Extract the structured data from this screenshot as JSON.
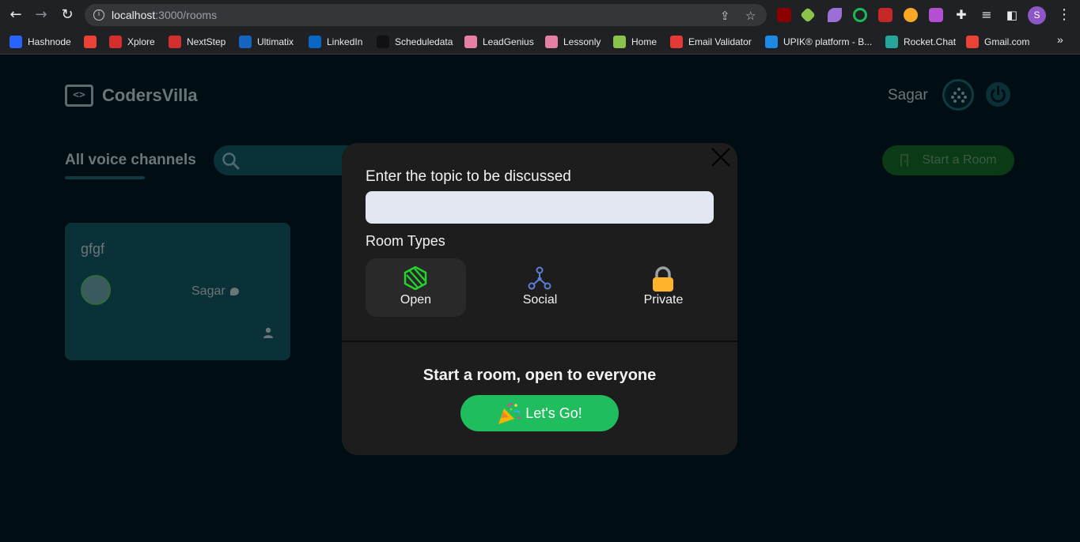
{
  "browser": {
    "url_host": "localhost",
    "url_path": ":3000/rooms",
    "profile_initial": "S",
    "bookmarks": [
      {
        "label": "Hashnode",
        "icon": "hashnode-icon",
        "color": "#2962ff"
      },
      {
        "label": "",
        "icon": "gmail-icon",
        "color": "#ea4335"
      },
      {
        "label": "Xplore",
        "icon": "tcs-icon",
        "color": "#d32f2f"
      },
      {
        "label": "NextStep",
        "icon": "tcs-icon",
        "color": "#d32f2f"
      },
      {
        "label": "Ultimatix",
        "icon": "tata-icon",
        "color": "#1565c0"
      },
      {
        "label": "LinkedIn",
        "icon": "linkedin-icon",
        "color": "#0a66c2"
      },
      {
        "label": "Scheduledata",
        "icon": "scheduledata-icon",
        "color": "#111111"
      },
      {
        "label": "LeadGenius",
        "icon": "brain-icon",
        "color": "#e57fa4"
      },
      {
        "label": "Lessonly",
        "icon": "brain-icon",
        "color": "#e57fa4"
      },
      {
        "label": "Home",
        "icon": "home-site-icon",
        "color": "#8bc34a"
      },
      {
        "label": "Email Validator",
        "icon": "email-validator-icon",
        "color": "#e53935"
      },
      {
        "label": "UPIK® platform - B...",
        "icon": "upik-icon",
        "color": "#1e88e5"
      },
      {
        "label": "Rocket.Chat",
        "icon": "rocketchat-icon",
        "color": "#26a69a"
      },
      {
        "label": "Gmail.com",
        "icon": "gmail-icon",
        "color": "#ea4335"
      }
    ]
  },
  "app": {
    "logo_text": "CodersVilla",
    "user_name": "Sagar",
    "tab_title": "All voice channels",
    "start_room_label": "Start a Room",
    "room": {
      "topic": "gfgf",
      "speaker": "Sagar"
    }
  },
  "modal": {
    "heading": "Enter the topic to be discussed",
    "topic_value": "",
    "types_heading": "Room Types",
    "types": [
      {
        "label": "Open",
        "icon": "open-globe-icon",
        "active": true
      },
      {
        "label": "Social",
        "icon": "social-network-icon",
        "active": false
      },
      {
        "label": "Private",
        "icon": "padlock-icon",
        "active": false
      }
    ],
    "footer_text": "Start a room, open to everyone",
    "go_label": "Let's Go!"
  },
  "colors": {
    "background": "#000e14",
    "card": "#0a3038",
    "modal": "#1d1d1d",
    "accent_green": "#20bd5f"
  }
}
